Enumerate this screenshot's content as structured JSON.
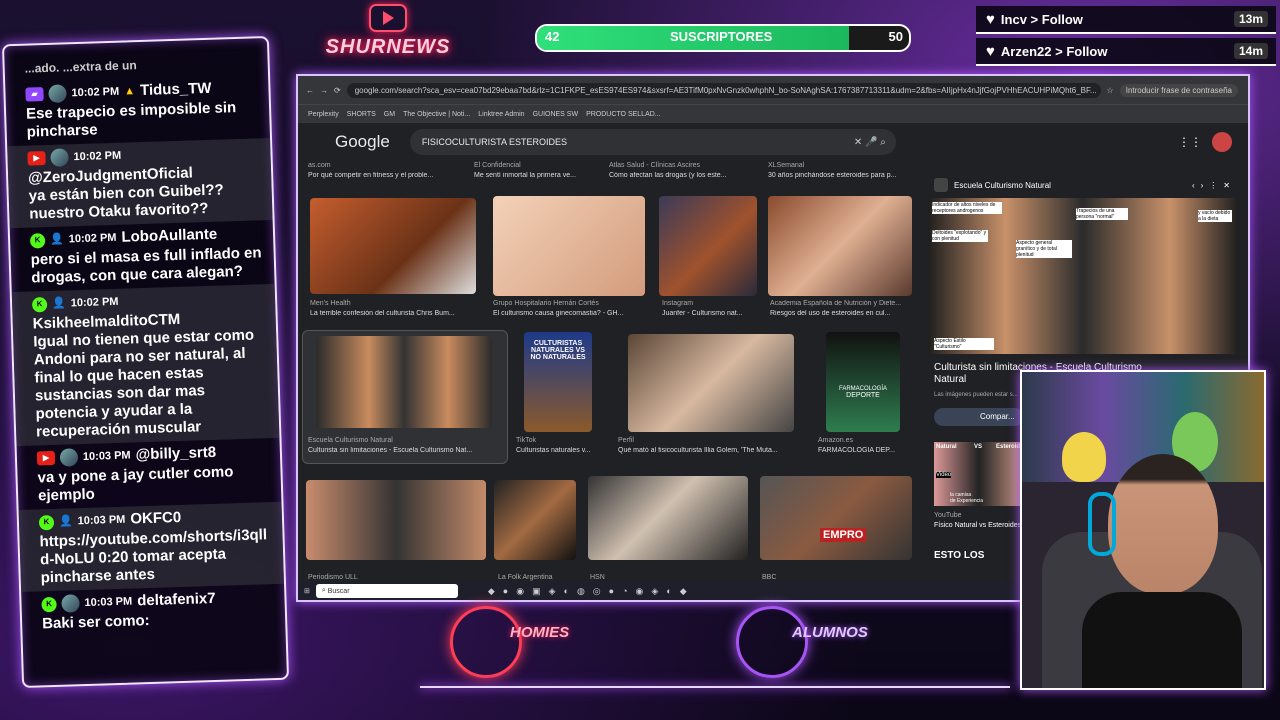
{
  "overlay": {
    "logo_name": "SHURNEWS",
    "sub_goal": {
      "current": "42",
      "label": "SUSCRIPTORES",
      "target": "50",
      "progress_fraction": 0.84
    },
    "follows": [
      {
        "user": "Incv",
        "action": "> Follow",
        "time": "13m"
      },
      {
        "user": "Arzen22",
        "action": "> Follow",
        "time": "14m"
      }
    ],
    "bottom_badges": [
      {
        "label": "HOMIES",
        "color": "#ff3d57"
      },
      {
        "label": "ALUMNOS",
        "color": "#a855f7"
      }
    ]
  },
  "chat": {
    "top_fragment": "...ado.          ...extra de un",
    "messages": [
      {
        "platform": "twitch",
        "time": "10:02 PM",
        "user": "Tidus_TW",
        "text": "Ese trapecio es imposible sin pincharse"
      },
      {
        "platform": "youtube",
        "time": "10:02 PM",
        "user": "@ZeroJudgmentOficial",
        "text": "ya están bien con Guibel?? nuestro Otaku favorito??"
      },
      {
        "platform": "kick",
        "time": "10:02 PM",
        "user": "LoboAullante",
        "text": "pero si el masa es full inflado en drogas, con que cara alegan?"
      },
      {
        "platform": "kick",
        "time": "10:02 PM",
        "user": "KsikheelmalditoCTM",
        "text": "Igual no tienen que estar como Andoni para no ser natural, al final lo que hacen estas sustancias son dar mas potencia y ayudar a la recuperación muscular"
      },
      {
        "platform": "youtube",
        "time": "10:03 PM",
        "user": "@billy_srt8",
        "text": "va y pone a jay cutler como ejemplo"
      },
      {
        "platform": "kick",
        "time": "10:03 PM",
        "user": "OKFC0",
        "text": "https://youtube.com/shorts/i3qll d-NoLU 0:20 tomar acepta pincharse antes"
      },
      {
        "platform": "kick",
        "time": "10:03 PM",
        "user": "deltafenix7",
        "text": "Baki ser como:"
      }
    ]
  },
  "browser": {
    "url": "google.com/search?sca_esv=cea07bd29ebaa7bd&rlz=1C1FKPE_esES974ES974&sxsrf=AE3TifM0pxNvGnzk0whphN_bo-SoNAghSA:1767387713311&udm=2&fbs=AIIjpHx4nJjfGojPVHhEACUHPiMQht6_BF...",
    "addr_right": "Introducir frase de contraseña",
    "bookmarks": [
      "Perplexity",
      "SHORTS",
      "GM",
      "The Objective | Noti...",
      "Linktree Admin",
      "GUIONES SW",
      "PRODUCTO SELLAD..."
    ],
    "search_query": "FISICOCULTURISTA ESTEROIDES",
    "logo": "Google",
    "top_row": [
      {
        "source": "as.com",
        "caption": "Por qué competir en fitness y el proble..."
      },
      {
        "source": "El Confidencial",
        "caption": "Me sentí inmortal la primera ve..."
      },
      {
        "source": "Atlas Salud - Clínicas Ascires",
        "caption": "Cómo afectan las drogas (y los este..."
      },
      {
        "source": "XLSemanal",
        "caption": "30 años pinchándose esteroides para p..."
      }
    ],
    "row1": [
      {
        "source": "Men's Health",
        "caption": "La terrible confesión del culturista Chris Bum..."
      },
      {
        "source": "Grupo Hospitalario Hernán Cortés",
        "caption": "El culturismo causa ginecomastia? - GH..."
      },
      {
        "source": "Instagram",
        "caption": "Juanfer - Culturismo nat..."
      },
      {
        "source": "Academia Española de Nutrición y Diete...",
        "caption": "Riesgos del uso de esteroides en cul..."
      }
    ],
    "row2": [
      {
        "source": "Escuela Culturismo Natural",
        "caption": "Culturista sin limitaciones - Escuela Culturismo Nat..."
      },
      {
        "source": "TikTok",
        "caption": "Culturistas naturales v..."
      },
      {
        "source": "Perfil",
        "caption": "Qué mató al fisicoculturista Illia Golem, 'The Muta..."
      },
      {
        "source": "Amazon.es",
        "caption": "FARMACOLOGÍA DEP..."
      }
    ],
    "row3_sources": [
      "Periodismo ULL",
      "La Folk Argentina",
      "HSN",
      "BBC"
    ],
    "thumb_texts": {
      "tiktok": "CULTURISTAS NATURALES VS NO NATURALES",
      "book": "DEPORTE",
      "book_title": "FARMACOLOGÍA",
      "empro": "EMPRO"
    },
    "side_pane": {
      "source": "Escuela Culturismo Natural",
      "title": "Culturista sin limitaciones - Escuela Culturismo Natural",
      "note": "Las imágenes pueden estar s...",
      "share": "Compar...",
      "related_source": "YouTube",
      "related_caption": "Físico Natural vs Esteroides",
      "related2": "ESTO LOS",
      "annotations": [
        "Indicador de altos niveles de receptores androgenos",
        "Deltoides \"explotando\" y con plenitud",
        "Aspecto general granítico y de total plenitud",
        "Trapecios de una persona \"normal\"",
        "y vacío debido a la dieta",
        "Aspecto Estilo \"Culturismo\""
      ],
      "related_labels": [
        "Natural",
        "VS",
        "Esteroides",
        "Video",
        "la camisa",
        "de Experiencia"
      ]
    },
    "taskbar_search": "Buscar"
  }
}
